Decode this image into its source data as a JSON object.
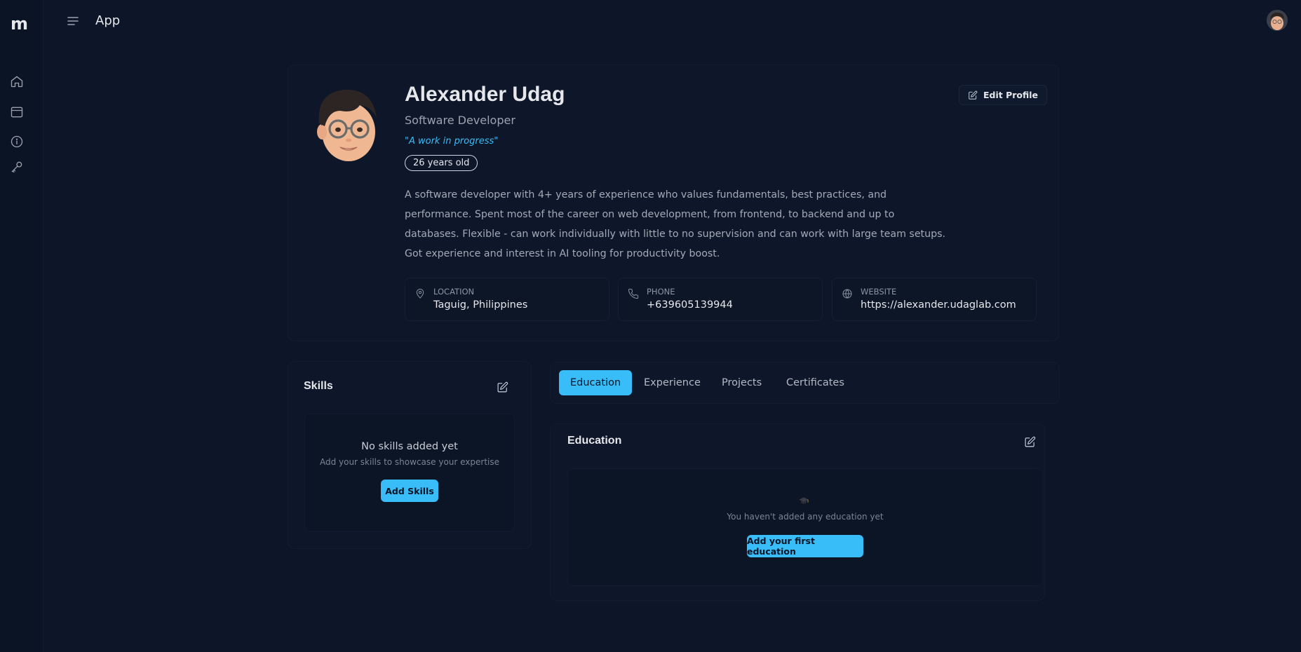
{
  "sidebar": {
    "logo": "m",
    "items": [
      {
        "icon": "home-icon"
      },
      {
        "icon": "window-icon"
      },
      {
        "icon": "info-icon"
      },
      {
        "icon": "key-icon"
      }
    ]
  },
  "header": {
    "menu_icon": "menu-icon",
    "title": "App"
  },
  "profile": {
    "name": "Alexander Udag",
    "role": "Software Developer",
    "motto": "\"A work in progress\"",
    "age": "26 years old",
    "bio": "A software developer with 4+ years of experience who values fundamentals, best practices, and performance. Spent most of the career on web development, from frontend, to backend and up to databases. Flexible - can work individually with little to no supervision and can work with large team setups. Got experience and interest in AI tooling for productivity boost.",
    "edit_label": "Edit Profile",
    "info": [
      {
        "icon": "location-pin-icon",
        "label": "Location",
        "value": "Taguig, Philippines"
      },
      {
        "icon": "phone-icon",
        "label": "Phone",
        "value": "+639605139944"
      },
      {
        "icon": "globe-icon",
        "label": "Website",
        "value": "https://alexander.udaglab.com"
      }
    ]
  },
  "skills": {
    "title": "Skills",
    "empty_title": "No skills added yet",
    "empty_sub": "Add your skills to showcase your expertise",
    "add_label": "Add Skills"
  },
  "tabs": [
    {
      "label": "Education",
      "active": true
    },
    {
      "label": "Experience",
      "active": false
    },
    {
      "label": "Projects",
      "active": false
    },
    {
      "label": "Certificates",
      "active": false
    }
  ],
  "education": {
    "title": "Education",
    "icon": "graduation-cap-icon",
    "empty_text": "You haven't added any education yet",
    "add_label": "Add your first education"
  },
  "colors": {
    "accent": "#38bdf8",
    "background": "#0d1628"
  }
}
